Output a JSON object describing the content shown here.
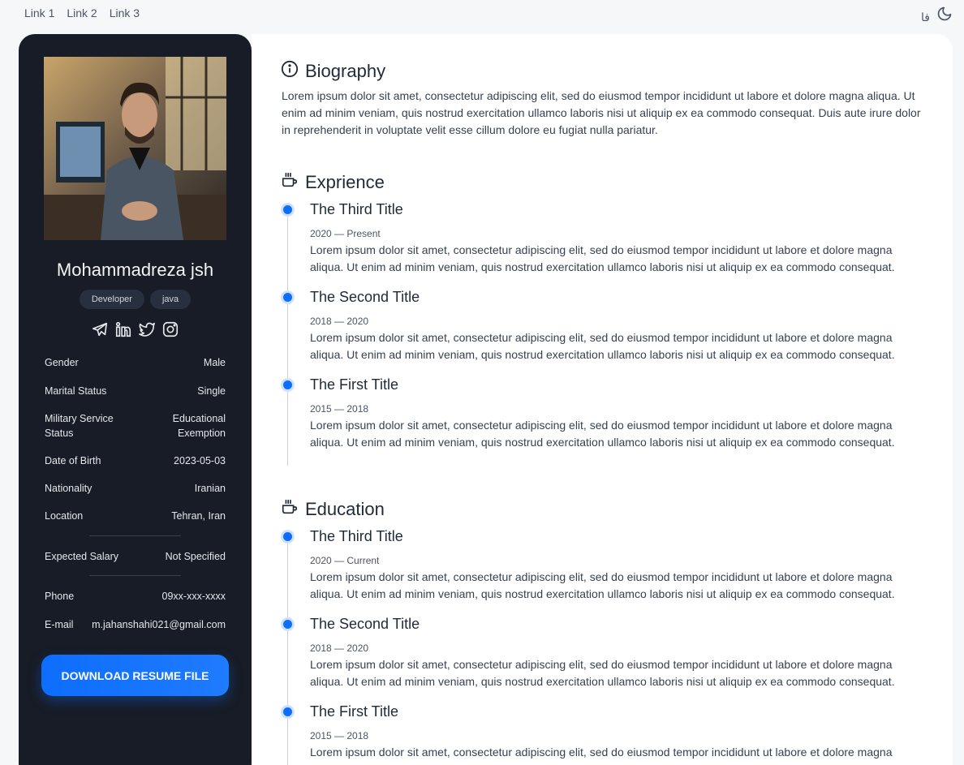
{
  "nav": {
    "links": [
      "Link 1",
      "Link 2",
      "Link 3"
    ],
    "lang": "فا"
  },
  "profile": {
    "name": "Mohammadreza jsh",
    "tags": [
      "Developer",
      "java"
    ],
    "info": [
      {
        "label": "Gender",
        "value": "Male"
      },
      {
        "label": "Marital Status",
        "value": "Single"
      },
      {
        "label": "Military Service Status",
        "value": "Educational Exemption"
      },
      {
        "label": "Date of Birth",
        "value": "2023-05-03"
      },
      {
        "label": "Nationality",
        "value": "Iranian"
      },
      {
        "label": "Location",
        "value": "Tehran, Iran"
      }
    ],
    "salary": {
      "label": "Expected Salary",
      "value": "Not Specified"
    },
    "phone": {
      "label": "Phone",
      "value": "09xx-xxx-xxxx"
    },
    "email": {
      "label": "E-mail",
      "value": "m.jahanshahi021@gmail.com"
    },
    "download_label": "DOWNLOAD RESUME FILE"
  },
  "biography": {
    "title": "Biography",
    "text": "Lorem ipsum dolor sit amet, consectetur adipiscing elit, sed do eiusmod tempor incididunt ut labore et dolore magna aliqua. Ut enim ad minim veniam, quis nostrud exercitation ullamco laboris nisi ut aliquip ex ea commodo consequat. Duis aute irure dolor in reprehenderit in voluptate velit esse cillum dolore eu fugiat nulla pariatur."
  },
  "experience": {
    "title": "Exprience",
    "items": [
      {
        "title": "The Third Title",
        "date": "2020 — Present",
        "desc": "Lorem ipsum dolor sit amet, consectetur adipiscing elit, sed do eiusmod tempor incididunt ut labore et dolore magna aliqua. Ut enim ad minim veniam, quis nostrud exercitation ullamco laboris nisi ut aliquip ex ea commodo consequat."
      },
      {
        "title": "The Second Title",
        "date": "2018 — 2020",
        "desc": "Lorem ipsum dolor sit amet, consectetur adipiscing elit, sed do eiusmod tempor incididunt ut labore et dolore magna aliqua. Ut enim ad minim veniam, quis nostrud exercitation ullamco laboris nisi ut aliquip ex ea commodo consequat."
      },
      {
        "title": "The First Title",
        "date": "2015 — 2018",
        "desc": "Lorem ipsum dolor sit amet, consectetur adipiscing elit, sed do eiusmod tempor incididunt ut labore et dolore magna aliqua. Ut enim ad minim veniam, quis nostrud exercitation ullamco laboris nisi ut aliquip ex ea commodo consequat."
      }
    ]
  },
  "education": {
    "title": "Education",
    "items": [
      {
        "title": "The Third Title",
        "date": "2020 — Current",
        "desc": "Lorem ipsum dolor sit amet, consectetur adipiscing elit, sed do eiusmod tempor incididunt ut labore et dolore magna aliqua. Ut enim ad minim veniam, quis nostrud exercitation ullamco laboris nisi ut aliquip ex ea commodo consequat."
      },
      {
        "title": "The Second Title",
        "date": "2018 — 2020",
        "desc": "Lorem ipsum dolor sit amet, consectetur adipiscing elit, sed do eiusmod tempor incididunt ut labore et dolore magna aliqua. Ut enim ad minim veniam, quis nostrud exercitation ullamco laboris nisi ut aliquip ex ea commodo consequat."
      },
      {
        "title": "The First Title",
        "date": "2015 — 2018",
        "desc": "Lorem ipsum dolor sit amet, consectetur adipiscing elit, sed do eiusmod tempor incididunt ut labore et dolore magna aliqua. Ut enim ad minim veniam, quis nostrud exercitation ullamco laboris nisi ut aliquip ex ea commodo consequat."
      }
    ]
  },
  "colors": {
    "accent": "#0d6efd",
    "sidebar_bg": "#171c26",
    "page_bg": "#f6f7f9"
  },
  "icons": [
    "info-icon",
    "coffee-cup-icon",
    "telegram-icon",
    "linkedin-icon",
    "twitter-icon",
    "instagram-icon",
    "moon-icon"
  ]
}
